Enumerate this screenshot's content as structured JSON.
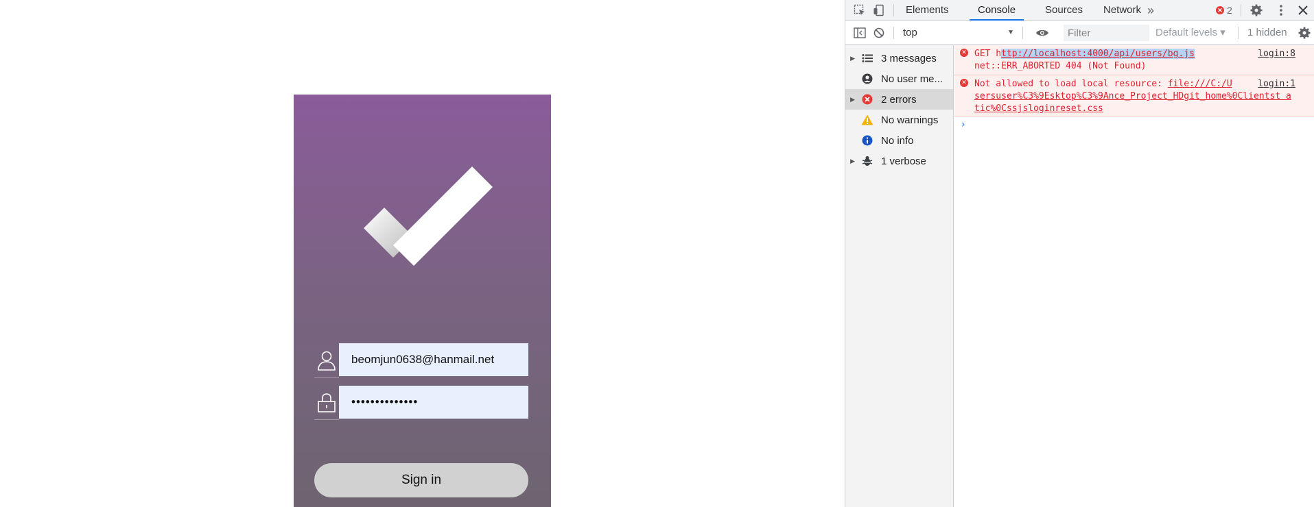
{
  "login": {
    "email_value": "beomjun0638@hanmail.net",
    "password_value": "••••••••••••••",
    "signin_label": "Sign in"
  },
  "devtools": {
    "tabs": [
      "Elements",
      "Console",
      "Sources",
      "Network"
    ],
    "active_tab": "Console",
    "more_tabs_glyph": "»",
    "error_count": "2",
    "context": "top",
    "filter_placeholder": "Filter",
    "levels_label": "Default levels ▾",
    "hidden_label": "1 hidden",
    "sidebar": [
      {
        "label": "3 messages",
        "icon": "list-icon",
        "expandable": true
      },
      {
        "label": "No user me...",
        "icon": "user-icon",
        "expandable": false
      },
      {
        "label": "2 errors",
        "icon": "error-icon",
        "expandable": true
      },
      {
        "label": "No warnings",
        "icon": "warning-icon",
        "expandable": false
      },
      {
        "label": "No info",
        "icon": "info-icon",
        "expandable": false
      },
      {
        "label": "1 verbose",
        "icon": "bug-icon",
        "expandable": true
      }
    ],
    "messages": [
      {
        "prefix": "GET h",
        "url": "ttp://localhost:4000/api/users/bg.js",
        "line2": "net::ERR_ABORTED 404 (Not Found)",
        "source": "login:8"
      },
      {
        "text": "Not allowed to load local resource: ",
        "url": "file:///C:/U",
        "line2": "sersuser%C3%9Esktop%C3%9Ance_Project_HDgit_home%0Clientst atic%0Cssjsloginreset.css",
        "source": "login:1"
      }
    ],
    "prompt_glyph": "›"
  },
  "colors": {
    "card_top": "#8a5c9a",
    "card_bottom": "#6d6470",
    "input_bg": "#e8f0fe",
    "button_bg": "#d1d1d1",
    "error_red": "#e53935",
    "accent_blue": "#1a73e8"
  }
}
